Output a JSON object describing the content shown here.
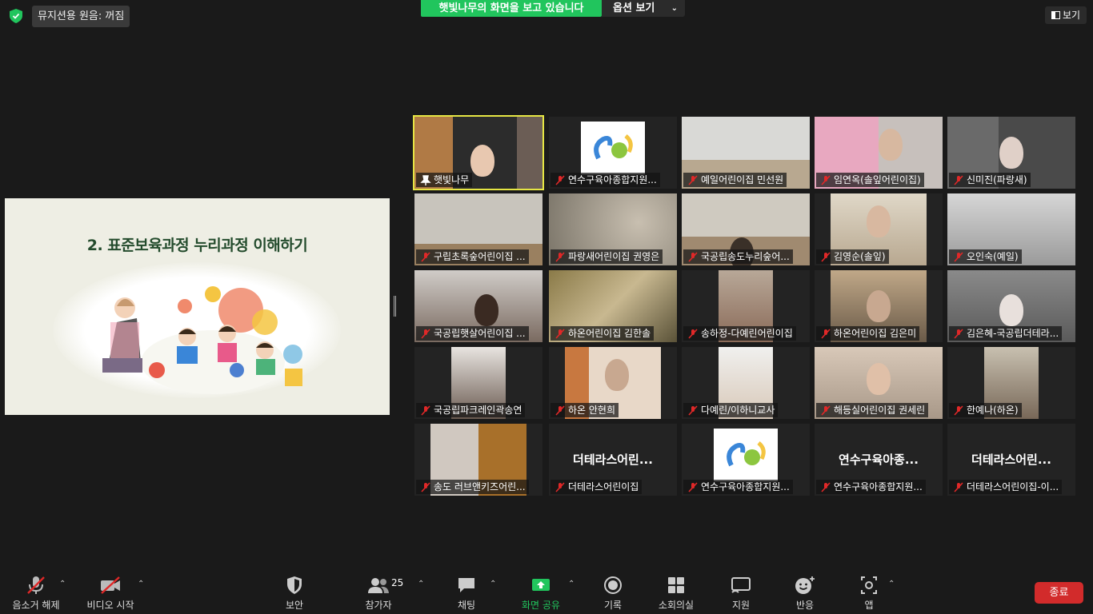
{
  "top": {
    "sound_status": "뮤지션용 원음: 꺼짐",
    "share_banner": "햇빛나무의 화면을 보고 있습니다",
    "view_options": "옵션 보기",
    "view_button": "보기"
  },
  "slide": {
    "title": "2. 표준보육과정 누리과정 이해하기"
  },
  "participants": [
    {
      "name": "햇빛나무",
      "big": ""
    },
    {
      "name": "연수구육아종합지원...",
      "big": ""
    },
    {
      "name": "예일어린이집 민선원",
      "big": ""
    },
    {
      "name": "임연옥(솔잎어린이집)",
      "big": ""
    },
    {
      "name": "신미진(파랑새)",
      "big": ""
    },
    {
      "name": "구립초록숲어린이집 ...",
      "big": ""
    },
    {
      "name": "파랑새어린이집 권영은",
      "big": ""
    },
    {
      "name": "국공립송도누리숲어...",
      "big": ""
    },
    {
      "name": "김영순(솔잎)",
      "big": ""
    },
    {
      "name": "오인숙(예일)",
      "big": ""
    },
    {
      "name": "국공립햇살어린이집 ...",
      "big": ""
    },
    {
      "name": "하온어린이집 김한솔",
      "big": ""
    },
    {
      "name": "송하정-다예린어린이집",
      "big": ""
    },
    {
      "name": "하온어린이집 김은미",
      "big": ""
    },
    {
      "name": "김은혜-국공립더테라...",
      "big": ""
    },
    {
      "name": "국공립파크레인곽송연",
      "big": ""
    },
    {
      "name": "하온 안현희",
      "big": ""
    },
    {
      "name": "다예린/이하니교사",
      "big": ""
    },
    {
      "name": "해등실어린이집 권세린",
      "big": ""
    },
    {
      "name": "한예나(하온)",
      "big": ""
    },
    {
      "name": "송도 러브앤키즈어린...",
      "big": ""
    },
    {
      "name": "더테라스어린이집",
      "big": "더테라스어린..."
    },
    {
      "name": "연수구육아종합지원...",
      "big": ""
    },
    {
      "name": "연수구육아종합지원...",
      "big": "연수구육아종..."
    },
    {
      "name": "더테라스어린이집-이...",
      "big": "더테라스어린..."
    }
  ],
  "toolbar": {
    "unmute": "음소거 해제",
    "start_video": "비디오 시작",
    "security": "보안",
    "participants": "참가자",
    "participant_count": "25",
    "chat": "채팅",
    "share_screen": "화면 공유",
    "record": "기록",
    "breakout": "소회의실",
    "support": "지원",
    "reactions": "반응",
    "apps": "앱",
    "end": "종료"
  },
  "colors": {
    "background": "#1a1a1a",
    "share_green": "#21c55d",
    "end_red": "#d22b2b",
    "active_speaker": "#e6e644",
    "mic_off_red": "#e02828"
  }
}
